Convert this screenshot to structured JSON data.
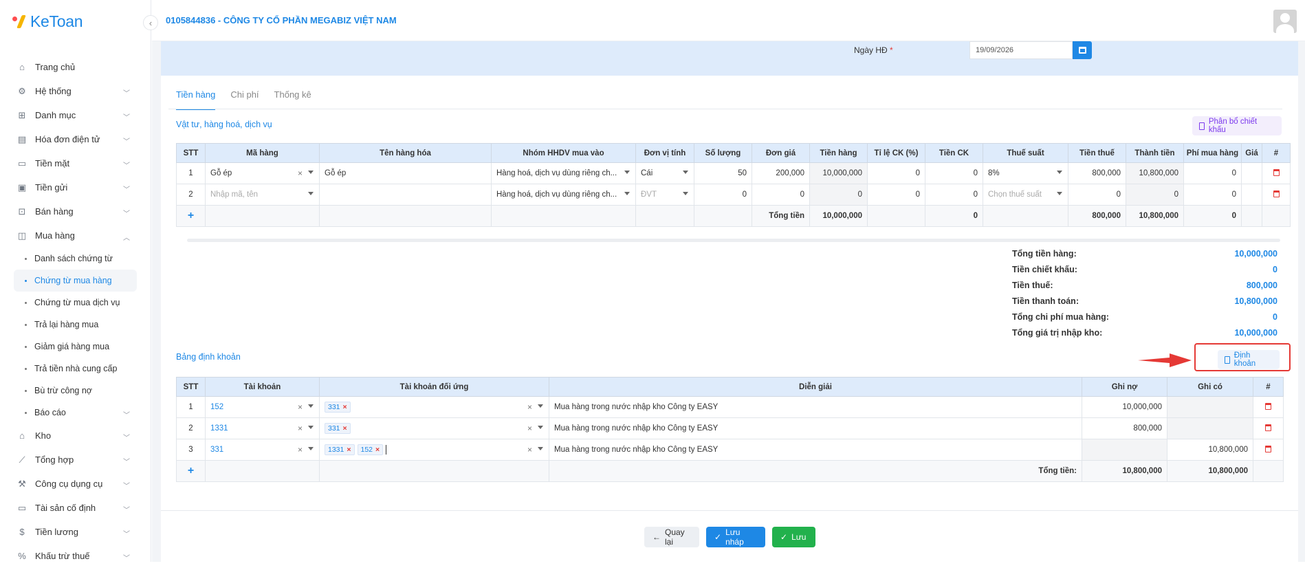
{
  "app": {
    "logo": "KeToan",
    "company": "0105844836 - CÔNG TY CỔ PHẦN MEGABIZ VIỆT NAM"
  },
  "sidebar": {
    "items": [
      {
        "label": "Trang chủ",
        "icon": "home-icon",
        "chevron": false
      },
      {
        "label": "Hệ thống",
        "icon": "gear-icon",
        "chevron": true
      },
      {
        "label": "Danh mục",
        "icon": "grid-icon",
        "chevron": true
      },
      {
        "label": "Hóa đơn điện tử",
        "icon": "invoice-icon",
        "chevron": true
      },
      {
        "label": "Tiền mặt",
        "icon": "cash-icon",
        "chevron": true
      },
      {
        "label": "Tiền gửi",
        "icon": "bank-icon",
        "chevron": true
      },
      {
        "label": "Bán hàng",
        "icon": "cart-icon",
        "chevron": true
      },
      {
        "label": "Mua hàng",
        "icon": "bag-icon",
        "chevron": true,
        "expanded": true
      }
    ],
    "sub_items": [
      {
        "label": "Danh sách chứng từ"
      },
      {
        "label": "Chứng từ mua hàng",
        "active": true
      },
      {
        "label": "Chứng từ mua dịch vụ"
      },
      {
        "label": "Trả lại hàng mua"
      },
      {
        "label": "Giảm giá hàng mua"
      },
      {
        "label": "Trả tiền nhà cung cấp"
      },
      {
        "label": "Bù trừ công nợ"
      },
      {
        "label": "Báo cáo",
        "chevron": true
      }
    ],
    "items_after": [
      {
        "label": "Kho",
        "icon": "warehouse-icon"
      },
      {
        "label": "Tổng hợp",
        "icon": "chart-icon"
      },
      {
        "label": "Công cụ dụng cụ",
        "icon": "tools-icon"
      },
      {
        "label": "Tài sản cố định",
        "icon": "car-icon"
      },
      {
        "label": "Tiền lương",
        "icon": "dollar-icon"
      },
      {
        "label": "Khấu trừ thuế",
        "icon": "tax-icon"
      }
    ]
  },
  "form": {
    "ngay_label": "Ngày HĐ",
    "required_mark": "*",
    "ngay_value": "19/09/2026"
  },
  "tabs": [
    "Tiền hàng",
    "Chi phí",
    "Thống kê"
  ],
  "goods": {
    "title": "Vật tư, hàng hoá, dịch vụ",
    "alloc_button": "Phân bổ chiết khấu",
    "headers": [
      "STT",
      "Mã hàng",
      "Tên hàng hóa",
      "Nhóm HHDV mua vào",
      "Đơn vị tính",
      "Số lượng",
      "Đơn giá",
      "Tiền hàng",
      "Tỉ lệ CK (%)",
      "Tiền CK",
      "Thuế suất",
      "Tiền thuế",
      "Thành tiền",
      "Phí mua hàng",
      "Giá",
      "#"
    ],
    "rows": [
      {
        "stt": "1",
        "ma": "Gỗ ép",
        "ten": "Gỗ ép",
        "nhom": "Hàng hoá, dịch vụ dùng riêng ch...",
        "dvt": "Cái",
        "sl": "50",
        "dongia": "200,000",
        "tienhang": "10,000,000",
        "tile": "0",
        "tienck": "0",
        "thue": "8%",
        "tienthue": "800,000",
        "thanhtien": "10,800,000",
        "phi": "0"
      },
      {
        "stt": "2",
        "ma_placeholder": "Nhập mã, tên",
        "ten": "",
        "nhom": "Hàng hoá, dịch vụ dùng riêng ch...",
        "dvt_placeholder": "ĐVT",
        "sl": "0",
        "dongia": "0",
        "tienhang": "0",
        "tile": "0",
        "tienck": "0",
        "thue_placeholder": "Chọn thuế suất",
        "tienthue": "0",
        "thanhtien": "0",
        "phi": "0"
      }
    ],
    "total": {
      "label": "Tổng tiền",
      "tienhang": "10,000,000",
      "tienck": "0",
      "tienthue": "800,000",
      "thanhtien": "10,800,000",
      "phi": "0"
    }
  },
  "summary": [
    {
      "label": "Tổng tiền hàng:",
      "value": "10,000,000"
    },
    {
      "label": "Tiền chiết khấu:",
      "value": "0"
    },
    {
      "label": "Tiền thuế:",
      "value": "800,000"
    },
    {
      "label": "Tiền thanh toán:",
      "value": "10,800,000"
    },
    {
      "label": "Tổng chi phí mua hàng:",
      "value": "0"
    },
    {
      "label": "Tổng giá trị nhập kho:",
      "value": "10,000,000"
    }
  ],
  "accounting": {
    "title": "Bảng định khoản",
    "button": "Định khoản",
    "headers": [
      "STT",
      "Tài khoản",
      "Tài khoản đối ứng",
      "Diễn giải",
      "Ghi nợ",
      "Ghi có",
      "#"
    ],
    "rows": [
      {
        "stt": "1",
        "tk": "152",
        "doiung": [
          "331"
        ],
        "diengiai": "Mua hàng trong nước nhập kho Công ty EASY",
        "no": "10,000,000",
        "co": ""
      },
      {
        "stt": "2",
        "tk": "1331",
        "doiung": [
          "331"
        ],
        "diengiai": "Mua hàng trong nước nhập kho Công ty EASY",
        "no": "800,000",
        "co": ""
      },
      {
        "stt": "3",
        "tk": "331",
        "doiung": [
          "1331",
          "152"
        ],
        "diengiai": "Mua hàng trong nước nhập kho Công ty EASY",
        "no": "",
        "co": "10,800,000"
      }
    ],
    "total": {
      "label": "Tổng tiền:",
      "no": "10,800,000",
      "co": "10,800,000"
    }
  },
  "footer": {
    "back": "Quay lại",
    "draft": "Lưu nháp",
    "save": "Lưu"
  }
}
